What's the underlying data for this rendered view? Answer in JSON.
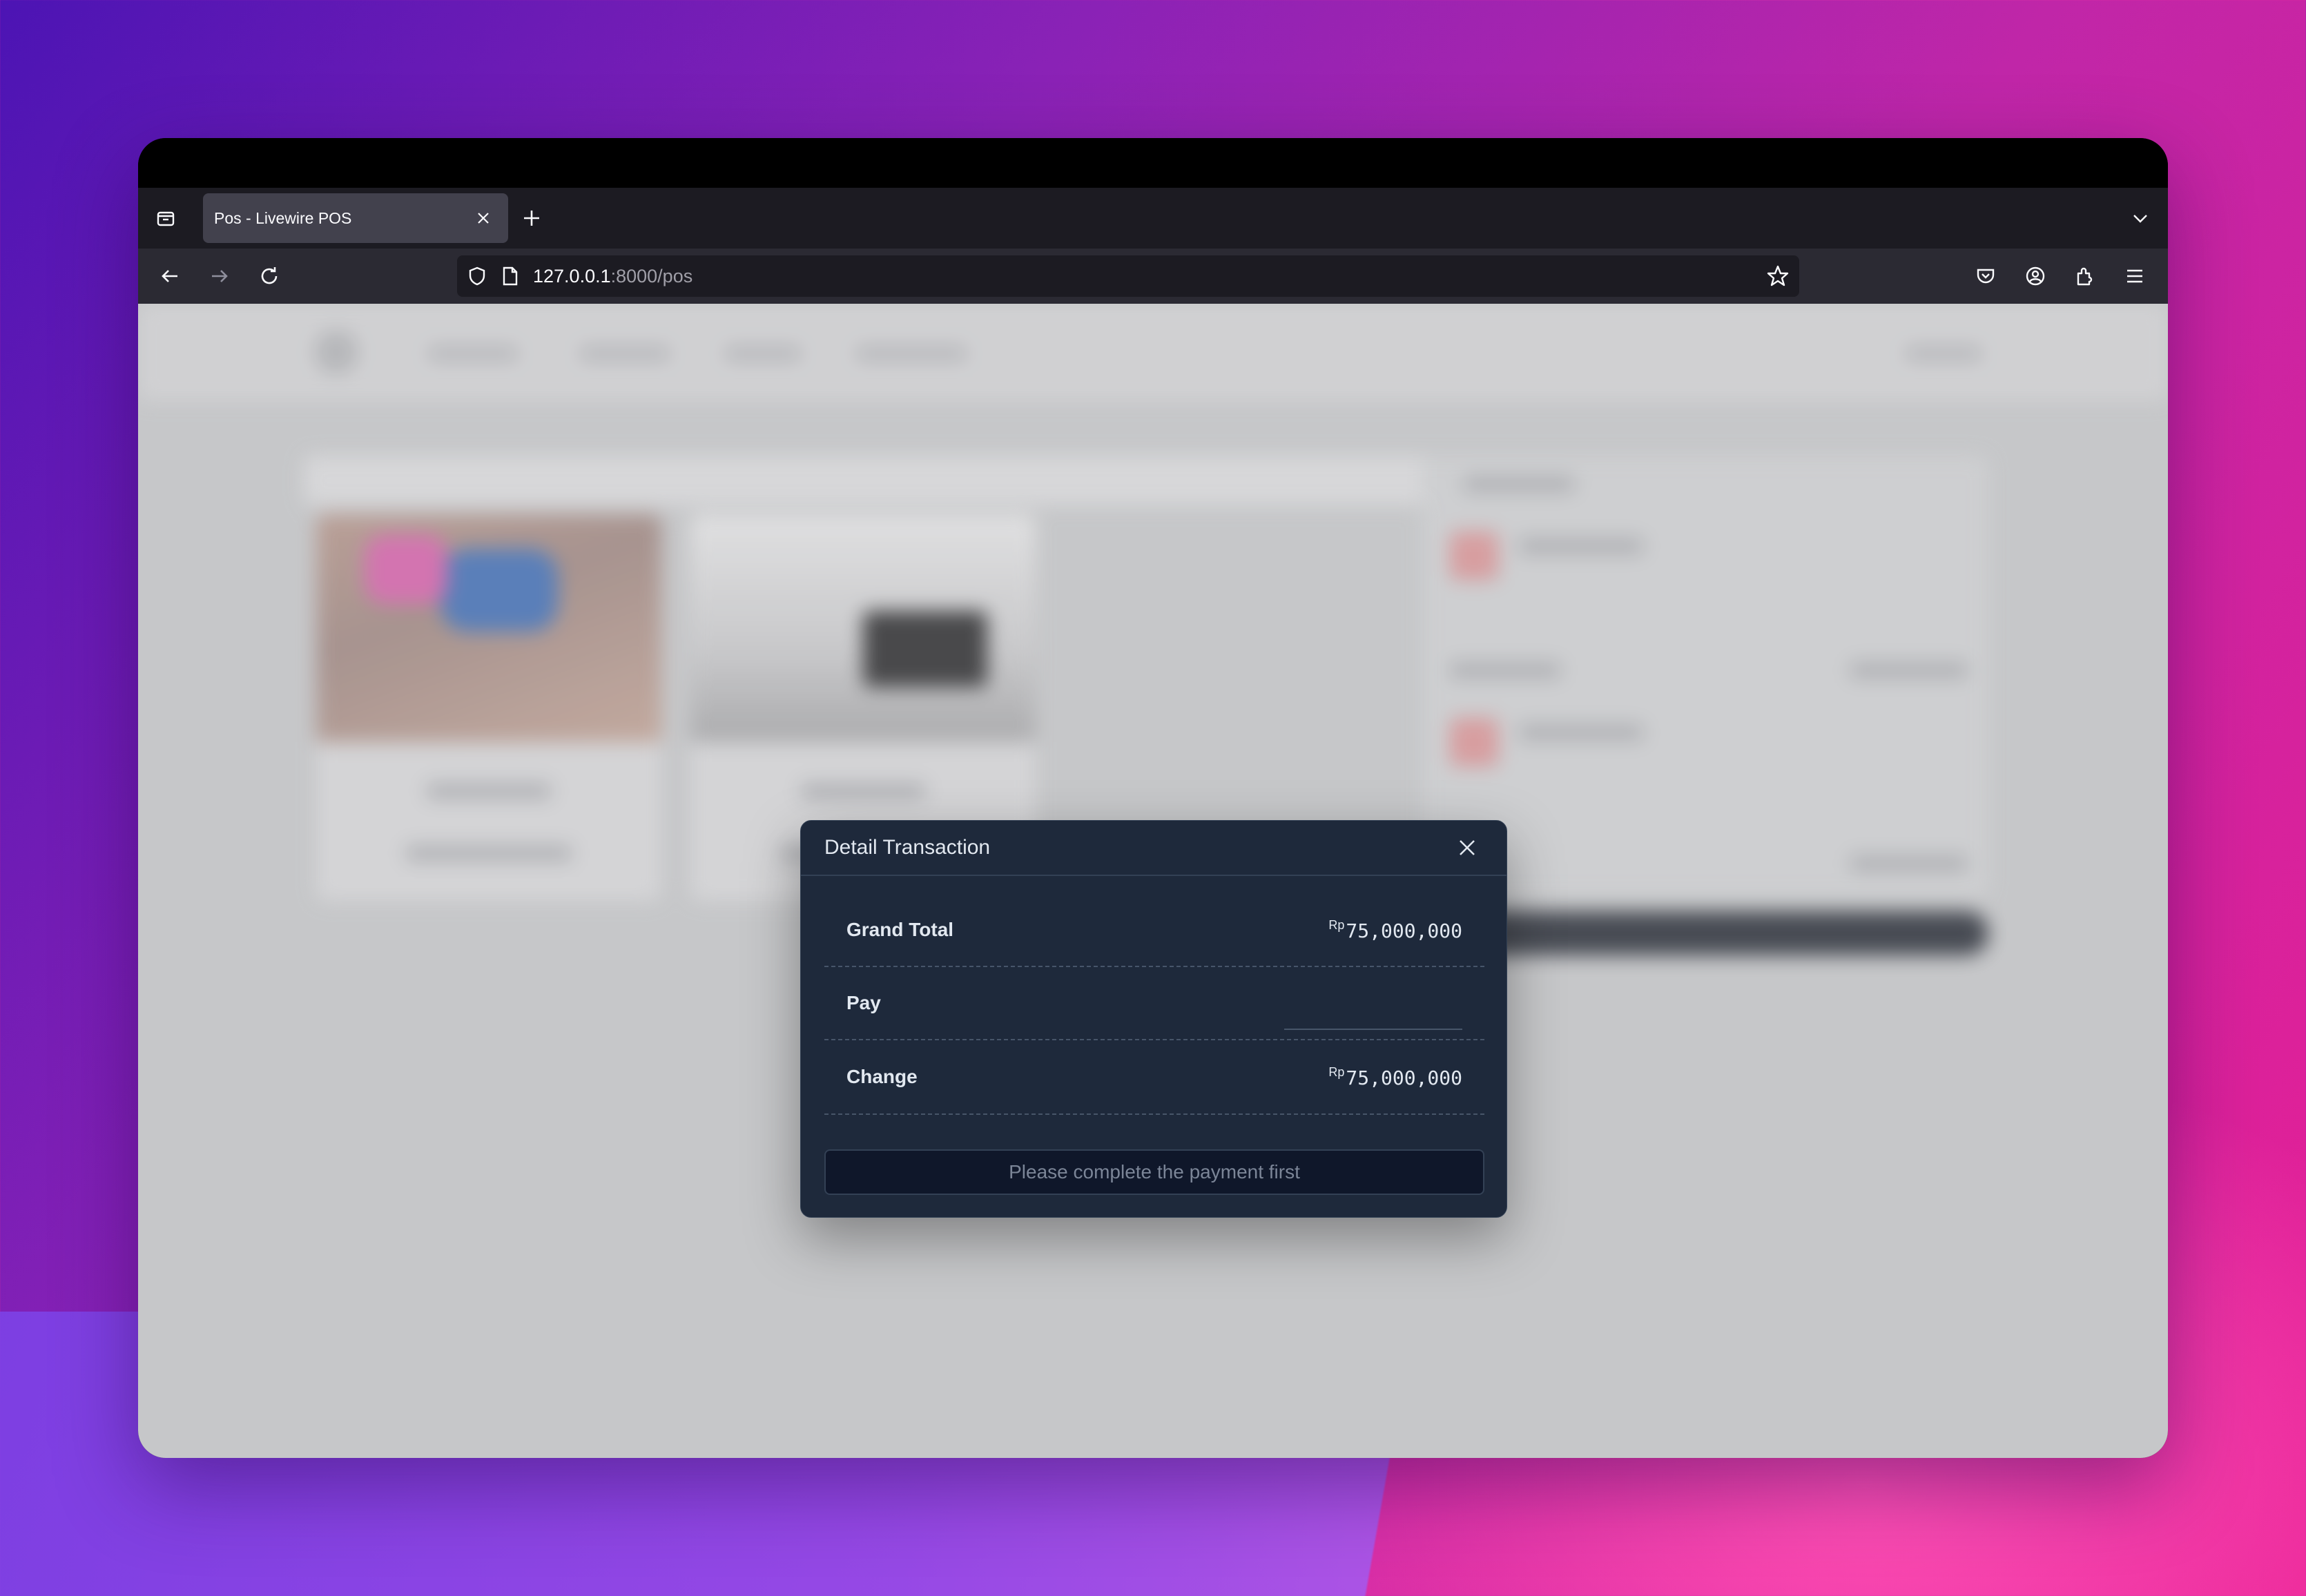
{
  "browser": {
    "tab_title": "Pos - Livewire POS",
    "url_host": "127.0.0.1",
    "url_path": ":8000/pos",
    "icons": [
      "tab-list-icon",
      "close-icon",
      "plus-icon",
      "chevron-down-icon",
      "back-icon",
      "forward-icon",
      "reload-icon",
      "shield-icon",
      "page-icon",
      "star-icon",
      "pocket-icon",
      "account-icon",
      "extensions-icon",
      "menu-icon"
    ]
  },
  "modal": {
    "title": "Detail Transaction",
    "grand_total_label": "Grand Total",
    "grand_total_currency": "Rp",
    "grand_total_value": "75,000,000",
    "pay_label": "Pay",
    "pay_value": "",
    "change_label": "Change",
    "change_currency": "Rp",
    "change_value": "75,000,000",
    "submit_label": "Please complete the payment first"
  },
  "colors": {
    "modal_bg": "#1e293b",
    "modal_border": "#334155",
    "button_bg": "#0f172a",
    "page_overlay": "#c6c7c9"
  }
}
